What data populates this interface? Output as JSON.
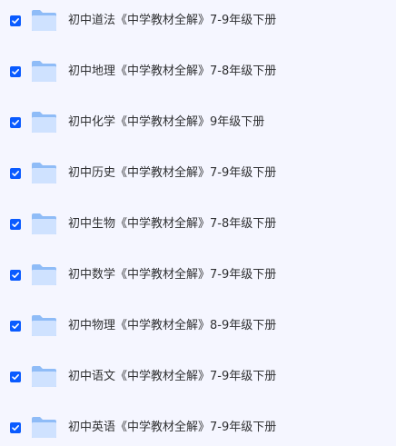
{
  "file_list": {
    "items": [
      {
        "name": "初中道法《中学教材全解》7-9年级下册",
        "checked": true,
        "icon": "folder-icon"
      },
      {
        "name": "初中地理《中学教材全解》7-8年级下册",
        "checked": true,
        "icon": "folder-icon"
      },
      {
        "name": "初中化学《中学教材全解》9年级下册",
        "checked": true,
        "icon": "folder-icon"
      },
      {
        "name": "初中历史《中学教材全解》7-9年级下册",
        "checked": true,
        "icon": "folder-icon"
      },
      {
        "name": "初中生物《中学教材全解》7-8年级下册",
        "checked": true,
        "icon": "folder-icon"
      },
      {
        "name": "初中数学《中学教材全解》7-9年级下册",
        "checked": true,
        "icon": "folder-icon"
      },
      {
        "name": "初中物理《中学教材全解》8-9年级下册",
        "checked": true,
        "icon": "folder-icon"
      },
      {
        "name": "初中语文《中学教材全解》7-9年级下册",
        "checked": true,
        "icon": "folder-icon"
      },
      {
        "name": "初中英语《中学教材全解》7-9年级下册",
        "checked": true,
        "icon": "folder-icon"
      }
    ]
  },
  "colors": {
    "background": "#f5f6ff",
    "checkbox": "#0a5bff",
    "folder_light": "#cfe2ff",
    "folder_dark": "#8fbcf7",
    "text": "#303133"
  }
}
